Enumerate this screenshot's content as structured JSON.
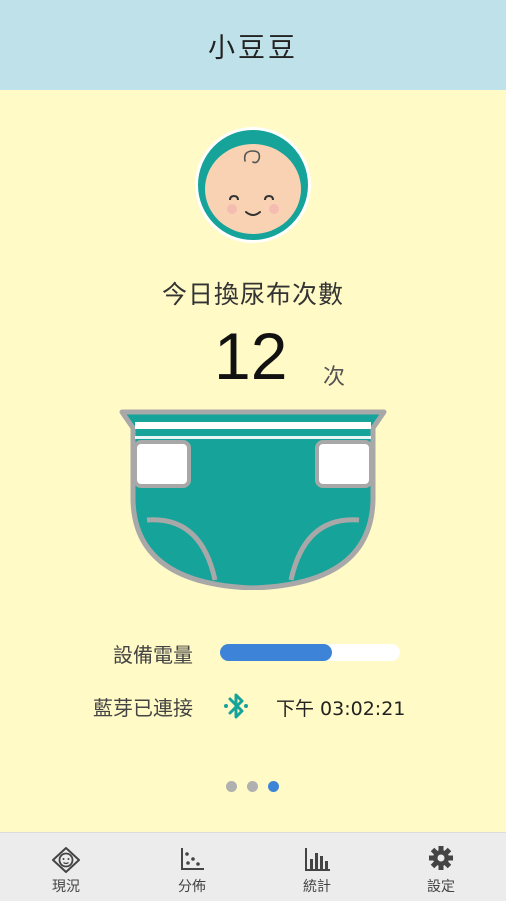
{
  "header": {
    "title": "小豆豆"
  },
  "main": {
    "daily_label": "今日換尿布次數",
    "count": "12",
    "count_unit": "次"
  },
  "status": {
    "battery_label": "設備電量",
    "battery_level": 0.62,
    "bluetooth_label": "藍芽已連接",
    "bluetooth_time": "下午 03:02:21"
  },
  "pager": {
    "count": 3,
    "active_index": 2
  },
  "tabs": [
    {
      "label": "現況",
      "icon": "baby-face-icon"
    },
    {
      "label": "分佈",
      "icon": "scatter-plot-icon"
    },
    {
      "label": "統計",
      "icon": "bar-chart-icon"
    },
    {
      "label": "設定",
      "icon": "gear-icon"
    }
  ],
  "colors": {
    "header_bg": "#bfe2ea",
    "page_bg": "#fffac6",
    "teal": "#15a39a",
    "battery_fill": "#3d84d8",
    "dot_active": "#3d84d8",
    "dot_inactive": "#b0b0b0"
  }
}
